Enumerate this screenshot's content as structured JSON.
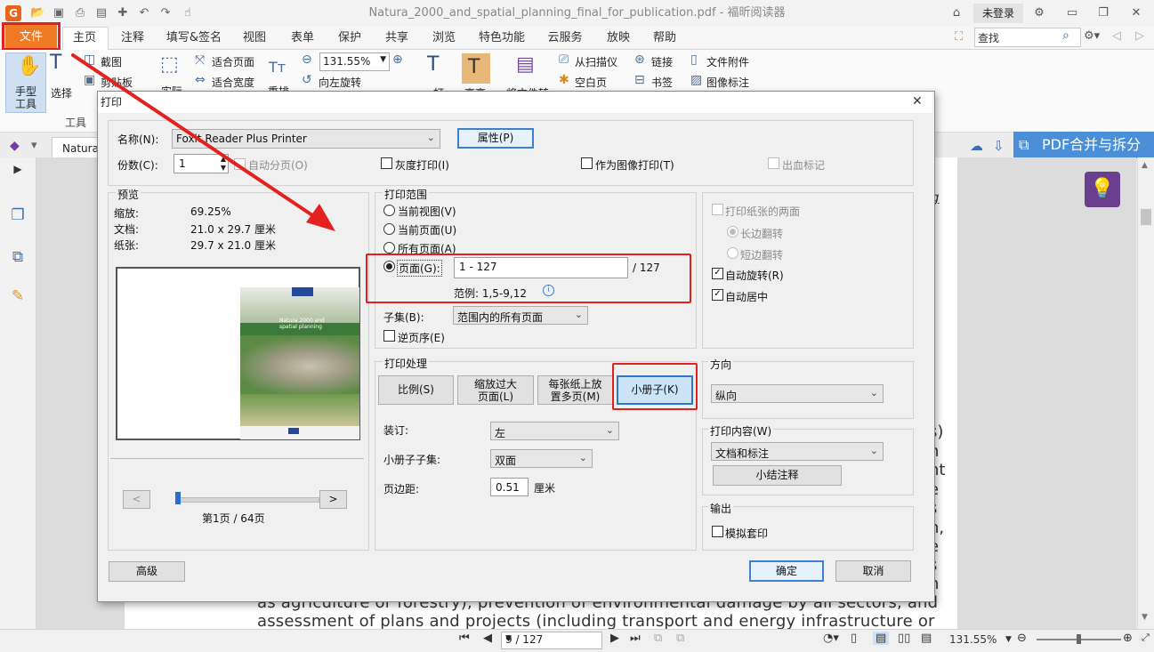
{
  "app": {
    "logo": "G",
    "window_title": "Natura_2000_and_spatial_planning_final_for_publication.pdf - 福昕阅读器",
    "login": "未登录",
    "search_placeholder": "查找"
  },
  "menu": {
    "tabs": [
      "文件",
      "主页",
      "注释",
      "填写&签名",
      "视图",
      "表单",
      "保护",
      "共享",
      "浏览",
      "特色功能",
      "云服务",
      "放映",
      "帮助"
    ]
  },
  "ribbon": {
    "hand_tool": "手型\n工具",
    "select": "选择",
    "screenshot": "截图",
    "clipboard": "剪贴板",
    "tools_group": "工具",
    "actual": "实际",
    "fit_page": "适合页面",
    "fit_width": "适合宽度",
    "zoom": "131.55%",
    "reflow": "重排",
    "rotate_left": "向左旋转",
    "typewriter": "打",
    "highlight": "高亮",
    "convert": "将文件转",
    "from_scanner": "从扫描仪",
    "blank_page": "空白页",
    "link": "链接",
    "bookmark": "书签",
    "file_attachment": "文件附件",
    "image_annotation": "图像标注"
  },
  "doc": {
    "tab_label": "Natura",
    "pdf_merge": "PDF合并与拆分",
    "italic_fragment": "g",
    "edge_chars": [
      "s)",
      "n",
      "nt",
      "e",
      "s",
      "n,",
      "e",
      "s",
      "h"
    ],
    "line1": "as agriculture or forestry), prevention of environmental damage by all sectors, and",
    "line2": "assessment of plans and projects (including transport and energy infrastructure or"
  },
  "statusbar": {
    "page": "9 / 127",
    "zoom": "131.55%"
  },
  "dialog": {
    "title": "打印",
    "printer_name_label": "名称(N):",
    "printer_name": "Foxit Reader Plus Printer",
    "properties": "属性(P)",
    "copies_label": "份数(C):",
    "copies": "1",
    "collate": "自动分页(O)",
    "grayscale": "灰度打印(I)",
    "print_as_image": "作为图像打印(T)",
    "bleed_marks": "出血标记",
    "preview": {
      "legend": "预览",
      "zoom_label": "缩放:",
      "zoom_value": "69.25%",
      "document_label": "文档:",
      "document_value": "21.0 x 29.7 厘米",
      "paper_label": "纸张:",
      "paper_value": "29.7 x 21.0 厘米",
      "prev": "<",
      "next": ">",
      "page_info": "第1页 / 64页",
      "cover_title": "Natura 2000 and spatial planning"
    },
    "range": {
      "legend": "打印范围",
      "current_view": "当前视图(V)",
      "current_page": "当前页面(U)",
      "all_pages": "所有页面(A)",
      "pages": "页面(G):",
      "pages_value": "1 - 127",
      "total": "/ 127",
      "example": "范例: 1,5-9,12",
      "subset_label": "子集(B):",
      "subset_value": "范围内的所有页面",
      "reverse": "逆页序(E)"
    },
    "duplex": {
      "both_sides": "打印纸张的两面",
      "long_edge": "长边翻转",
      "short_edge": "短边翻转",
      "auto_rotate": "自动旋转(R)",
      "auto_center": "自动居中"
    },
    "handling": {
      "legend": "打印处理",
      "scale": "比例(S)",
      "fit_large": "缩放过大\n页面(L)",
      "multiple": "每张纸上放\n置多页(M)",
      "booklet": "小册子(K)",
      "binding_label": "装订:",
      "binding_value": "左",
      "subset_label": "小册子子集:",
      "subset_value": "双面",
      "margin_label": "页边距:",
      "margin_value": "0.51",
      "margin_unit": "厘米"
    },
    "orientation": {
      "legend": "方向",
      "value": "纵向"
    },
    "content": {
      "legend": "打印内容(W)",
      "value": "文档和标注",
      "summarize": "小结注释"
    },
    "output": {
      "legend": "输出",
      "simulate_overprint": "模拟套印"
    },
    "advanced": "高级",
    "ok": "确定",
    "cancel": "取消"
  }
}
